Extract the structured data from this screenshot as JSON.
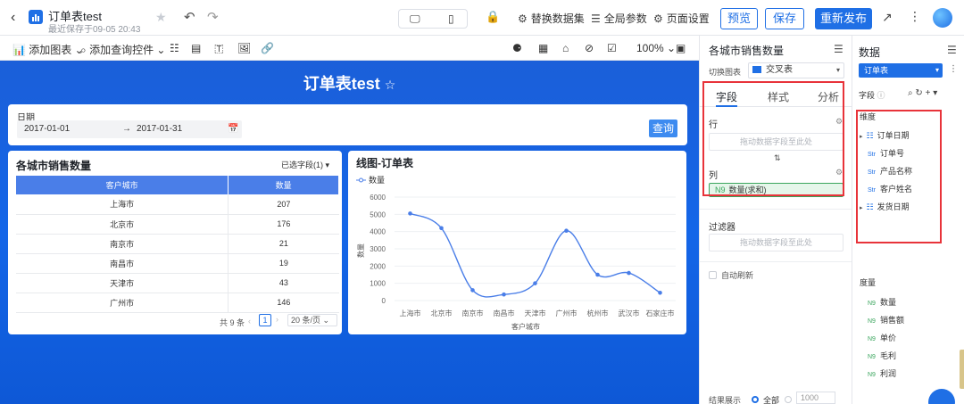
{
  "header": {
    "title": "订单表test",
    "subtitle": "最近保存于09-05 20:43",
    "replace_dataset": "替换数据集",
    "global_params": "全局参数",
    "page_settings": "页面设置",
    "preview": "预览",
    "save": "保存",
    "republish": "重新发布"
  },
  "toolbar": {
    "add_chart": "添加图表",
    "add_query": "添加查询控件",
    "zoom": "100%"
  },
  "canvas": {
    "title": "订单表test",
    "filter": {
      "label": "日期",
      "start": "2017-01-01",
      "end": "2017-01-31",
      "query_button": "查询"
    },
    "table": {
      "title": "各城市销售数量",
      "selected_fields": "已选字段(1)",
      "headers": [
        "客户城市",
        "数量"
      ],
      "rows": [
        [
          "上海市",
          "207"
        ],
        [
          "北京市",
          "176"
        ],
        [
          "南京市",
          "21"
        ],
        [
          "南昌市",
          "19"
        ],
        [
          "天津市",
          "43"
        ],
        [
          "广州市",
          "146"
        ]
      ],
      "total": "共 9 条",
      "page": "1",
      "page_size": "20 条/页"
    }
  },
  "chart_data": {
    "type": "line",
    "title": "线图-订单表",
    "legend": "数量",
    "xlabel": "客户城市",
    "ylabel": "数量",
    "categories": [
      "上海市",
      "北京市",
      "南京市",
      "南昌市",
      "天津市",
      "广州市",
      "杭州市",
      "武汉市",
      "石家庄市"
    ],
    "values": [
      5050,
      4200,
      600,
      350,
      1000,
      4050,
      1500,
      1600,
      450
    ],
    "ylim": [
      0,
      6000
    ],
    "yticks": [
      "0",
      "1000",
      "2000",
      "3000",
      "4000",
      "5000",
      "6000"
    ],
    "color": "#4a7ee8"
  },
  "config_panel": {
    "title": "各城市销售数量",
    "switch_label": "切换图表",
    "chart_type": "交叉表",
    "tabs": [
      "字段",
      "样式",
      "分析"
    ],
    "row_label": "行",
    "row_drop": "拖动数据字段至此处",
    "col_label": "列",
    "col_field_type": "N9",
    "col_field": "数量(求和)",
    "filter_label": "过滤器",
    "filter_drop": "拖动数据字段至此处",
    "auto_refresh": "自动刷新",
    "result_label": "结果展示",
    "result_all": "全部",
    "result_limit": "1000"
  },
  "data_panel": {
    "title": "数据",
    "dataset": "订单表",
    "fields_label": "字段",
    "dimension_label": "维度",
    "dimensions": [
      {
        "type": "hier",
        "name": "订单日期"
      },
      {
        "type": "Str",
        "name": "订单号"
      },
      {
        "type": "Str",
        "name": "产品名称"
      },
      {
        "type": "Str",
        "name": "客户姓名"
      },
      {
        "type": "hier",
        "name": "发货日期"
      }
    ],
    "measure_label": "度量",
    "measures": [
      {
        "type": "N9",
        "name": "数量"
      },
      {
        "type": "N9",
        "name": "销售额"
      },
      {
        "type": "N9",
        "name": "单价"
      },
      {
        "type": "N9",
        "name": "毛利"
      },
      {
        "type": "N9",
        "name": "利润"
      }
    ]
  },
  "colors": {
    "accent": "#1f6fe5",
    "highlight_border": "#e8333a",
    "canvas_bg": "#1466e8",
    "measure": "#3aa55d"
  }
}
